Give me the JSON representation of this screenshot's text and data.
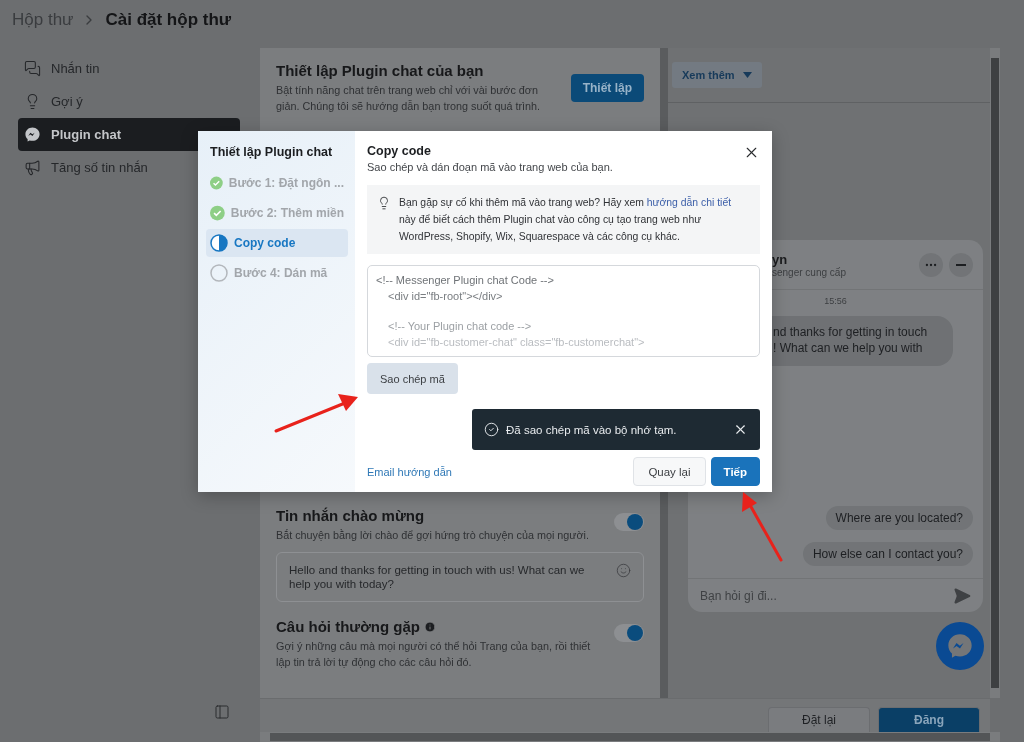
{
  "breadcrumb": {
    "parent": "Hộp thư",
    "current": "Cài đặt hộp thư"
  },
  "sidebar": {
    "items": [
      {
        "label": "Nhắn tin",
        "selected": false
      },
      {
        "label": "Gợi ý",
        "selected": false
      },
      {
        "label": "Plugin chat",
        "selected": true
      },
      {
        "label": "Tăng số tin nhắn",
        "selected": false
      }
    ]
  },
  "setup_card": {
    "title": "Thiết lập Plugin chat của bạn",
    "description": "Bật tính năng chat trên trang web chỉ với vài bước đơn giản. Chúng tôi sẽ hướng dẫn bạn trong suốt quá trình.",
    "button": "Thiết lập"
  },
  "welcome": {
    "title": "Tin nhắn chào mừng",
    "description": "Bắt chuyện bằng lời chào để gợi hứng trò chuyện của mọi người.",
    "on": true,
    "message": "Hello and thanks for getting in touch with us! What can we help you with today?"
  },
  "faq": {
    "title": "Câu hỏi thường gặp",
    "description": "Gợi ý những câu mà mọi người có thể hỏi Trang của bạn, rồi thiết lập tin trả lời tự động cho các câu hỏi đó.",
    "on": true
  },
  "preview": {
    "more_button": "Xem thêm",
    "chat": {
      "name": "yn",
      "subtitle": "senger cung cấp",
      "time": "15:56",
      "message_lines": [
        "nd thanks for getting in touch",
        "! What can we help you with"
      ],
      "quick_replies": [
        "Where are you located?",
        "How else can I contact you?"
      ],
      "input_placeholder": "Bạn hỏi gì đi..."
    }
  },
  "footer": {
    "buttons": [
      {
        "label": "Đặt lại",
        "kind": "secondary"
      },
      {
        "label": "Đăng",
        "kind": "primary"
      }
    ]
  },
  "modal": {
    "sidebar_title": "Thiết lập Plugin chat",
    "steps": [
      {
        "label": "Bước 1: Đặt ngôn ...",
        "checked": true,
        "selected": false
      },
      {
        "label": "Bước 2: Thêm miền",
        "checked": true,
        "selected": false
      },
      {
        "label": "Copy code",
        "checked": false,
        "selected": true
      },
      {
        "label": "Bước 4: Dán mã",
        "checked": false,
        "selected": false
      }
    ],
    "title": "Copy code",
    "subtitle": "Sao chép và dán đoạn mã vào trang web của bạn.",
    "tip": {
      "before": "Bạn gặp sự cố khi thêm mã vào trang web? Hãy xem ",
      "link": "hướng dẫn chi tiết",
      "after": " này để biết cách thêm Plugin chat vào công cụ tạo trang web như WordPress, Shopify, Wix, Squarespace và các công cụ khác."
    },
    "code_blocks": [
      [
        {
          "text": "<!-- Messenger Plugin chat Code -->",
          "indented": false
        },
        {
          "text": "<div id=\"fb-root\"></div>",
          "indented": true
        }
      ],
      [
        {
          "text": "<!-- Your Plugin chat code -->",
          "indented": true
        },
        {
          "text": "<div id=\"fb-customer-chat\" class=\"fb-customerchat\">",
          "indented": true
        }
      ]
    ],
    "copy_button": "Sao chép mã",
    "toast": {
      "message": "Đã sao chép mã vào bộ nhớ tạm."
    },
    "footer_link": "Email hướng dẫn",
    "buttons": [
      {
        "label": "Quay lại",
        "kind": "secondary"
      },
      {
        "label": "Tiếp",
        "kind": "primary"
      }
    ]
  }
}
